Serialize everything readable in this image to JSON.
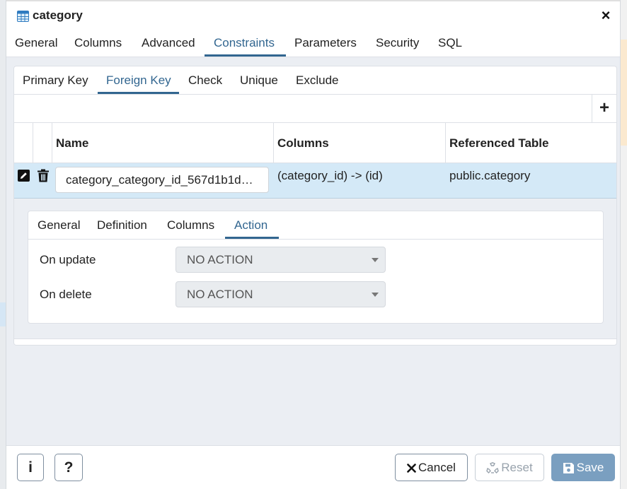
{
  "dialog": {
    "title": "category",
    "icon": "table-icon",
    "close_label": "×"
  },
  "tabs": [
    {
      "label": "General",
      "active": false
    },
    {
      "label": "Columns",
      "active": false
    },
    {
      "label": "Advanced",
      "active": false
    },
    {
      "label": "Constraints",
      "active": true
    },
    {
      "label": "Parameters",
      "active": false
    },
    {
      "label": "Security",
      "active": false
    },
    {
      "label": "SQL",
      "active": false
    }
  ],
  "constraint_tabs": [
    {
      "label": "Primary Key",
      "active": false
    },
    {
      "label": "Foreign Key",
      "active": true
    },
    {
      "label": "Check",
      "active": false
    },
    {
      "label": "Unique",
      "active": false
    },
    {
      "label": "Exclude",
      "active": false
    }
  ],
  "grid": {
    "add_label": "+",
    "headers": {
      "name": "Name",
      "columns": "Columns",
      "referenced_table": "Referenced Table"
    },
    "rows": [
      {
        "name": "category_category_id_567d1b1d…",
        "columns": "(category_id) -> (id)",
        "referenced_table": "public.category"
      }
    ]
  },
  "detail": {
    "tabs": [
      {
        "label": "General",
        "active": false
      },
      {
        "label": "Definition",
        "active": false
      },
      {
        "label": "Columns",
        "active": false
      },
      {
        "label": "Action",
        "active": true
      }
    ],
    "on_update": {
      "label": "On update",
      "value": "NO ACTION"
    },
    "on_delete": {
      "label": "On delete",
      "value": "NO ACTION"
    }
  },
  "footer": {
    "info_label": "i",
    "help_label": "?",
    "cancel_label": "Cancel",
    "reset_label": "Reset",
    "save_label": "Save"
  },
  "colors": {
    "accent": "#326690",
    "selected_row": "#d4e9f7",
    "save_button": "#7a9fc0"
  }
}
